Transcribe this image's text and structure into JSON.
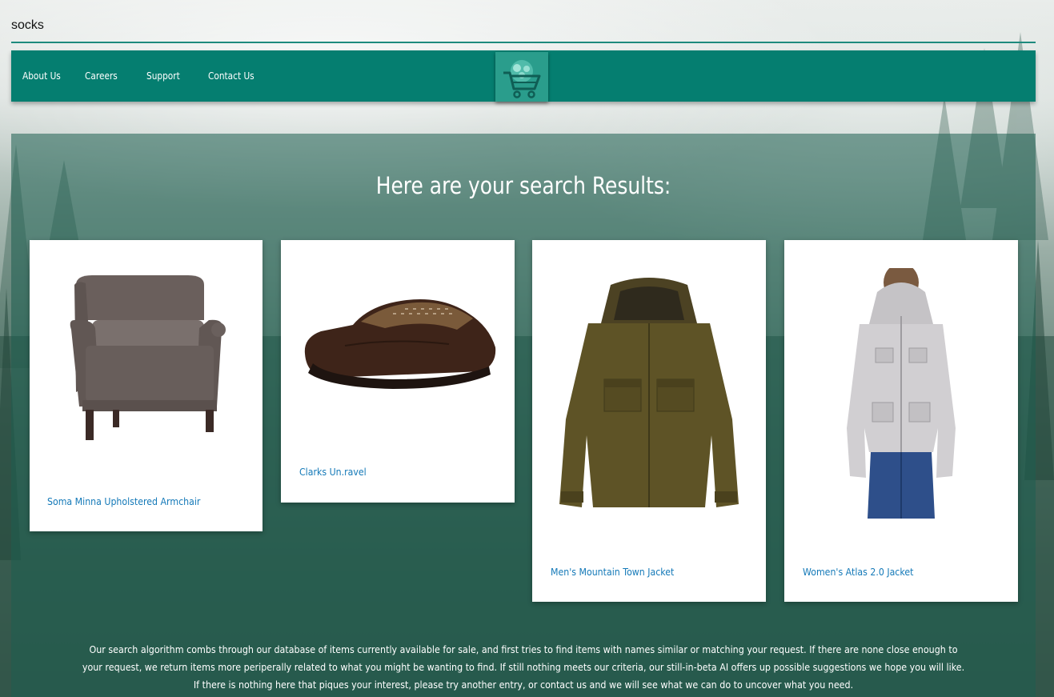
{
  "search": {
    "value": "socks"
  },
  "nav": {
    "items": [
      {
        "label": "About Us"
      },
      {
        "label": "Careers"
      },
      {
        "label": "Support"
      },
      {
        "label": "Contact Us"
      }
    ],
    "logo_icon": "shopping-cart-icon"
  },
  "results": {
    "title": "Here are your search Results:",
    "items": [
      {
        "name": "Soma Minna Upholstered Armchair",
        "image": "armchair-image"
      },
      {
        "name": "Clarks Un.ravel",
        "image": "shoe-image"
      },
      {
        "name": "Men's Mountain Town Jacket",
        "image": "mens-jacket-image"
      },
      {
        "name": "Women's Atlas 2.0 Jacket",
        "image": "womens-jacket-image"
      }
    ],
    "footer": "Our search algorithm combs through our database of items currently available for sale, and first tries to find items with names similar or matching your request. If there are none close enough to your request, we return items more periperally related to what you might be wanting to find. If still nothing meets our criteria, our still-in-beta AI offers up possible suggestions we hope you will like. If there is nothing here that piques your interest, please try another entry, or contact us and we will see what we can do to uncover what you need."
  },
  "colors": {
    "nav_bg": "#057e70",
    "link": "#1479b8",
    "accent": "#1e8a7d"
  }
}
